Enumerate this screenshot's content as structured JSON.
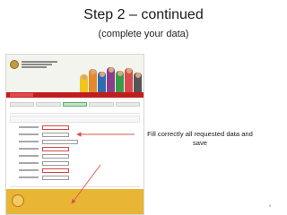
{
  "slide": {
    "title": "Step 2 – continued",
    "subtitle": "(complete your data)",
    "callout": "Fill correctly all requested data and save",
    "page_number": "9"
  },
  "colors": {
    "header_red": "#c01d1d",
    "footer_gold": "#e9b535",
    "arrow_red": "#d9534f",
    "save_blue": "#2b64c0"
  },
  "icons": {
    "university_seal": "seal-icon",
    "footer_seal": "seal-icon"
  }
}
